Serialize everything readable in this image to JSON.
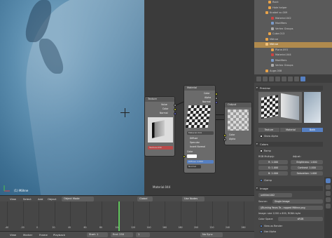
{
  "viewport": {
    "object_label": "(1) Mähne",
    "mode": "Object Mode"
  },
  "node_editor": {
    "status_label": "Material.044",
    "nodes": {
      "texture": {
        "title": "Texture",
        "outputs": [
          "Value",
          "Color",
          "Normal"
        ],
        "texture_name": "Texture.034"
      },
      "material": {
        "title": "Material",
        "outputs": [
          "Color",
          "Alpha",
          "Normal"
        ],
        "inputs": [
          "Color",
          "Spec",
          "Refl",
          "Normal"
        ],
        "options": [
          "Diffuse",
          "Specular",
          "Invert Normal"
        ],
        "material_name": "Material.044",
        "diffuse_value": "Diffuse: 0.800",
        "blend_label": "Normal"
      },
      "output": {
        "title": "Output",
        "inputs": [
          "Color",
          "Alpha"
        ]
      }
    }
  },
  "outliner": {
    "items": [
      {
        "label": "Rock",
        "state": "normal"
      },
      {
        "label": "Hole helper",
        "state": "normal"
      },
      {
        "label": "Knabel sc.009",
        "state": "normal"
      },
      {
        "label": "Material.042",
        "state": "normal"
      },
      {
        "label": "Modifiers",
        "state": "normal"
      },
      {
        "label": "Vertex Groups",
        "state": "normal"
      },
      {
        "label": "Cube.013",
        "state": "sel"
      },
      {
        "label": "Mähne",
        "state": "normal"
      },
      {
        "label": "Mähne",
        "state": "act"
      },
      {
        "label": "Plane.093",
        "state": "normal"
      },
      {
        "label": "Material.044",
        "state": "normal"
      },
      {
        "label": "Modifiers",
        "state": "normal"
      },
      {
        "label": "Vertex Groups",
        "state": "normal"
      },
      {
        "label": "Auge.008",
        "state": "normal"
      },
      {
        "label": "Auge.009",
        "state": "normal"
      }
    ]
  },
  "properties": {
    "preview_title": "Preview",
    "preview_tabs": [
      "Texture",
      "Material",
      "Both"
    ],
    "preview_tab_active": "Both",
    "show_alpha": "Show Alpha",
    "colors_title": "Colors",
    "ramp": "Ramp",
    "rgb_multiply": "RGB Multiply:",
    "adjust": "Adjust:",
    "r": "R:",
    "r_val": "1.000",
    "g": "G:",
    "g_val": "1.000",
    "b": "B:",
    "b_val": "1.000",
    "brightness": "Brightness:",
    "brightness_val": "1.000",
    "contrast": "Contrast:",
    "contrast_val": "1.000",
    "saturation": "Saturation:",
    "saturation_val": "1.000",
    "clamp": "Clamp",
    "image_title": "Image",
    "image_name": "untitled.002",
    "source_label": "Source:",
    "source_value": "Single Image",
    "file_path": "//Burning Years Te...rapped Mähne.png",
    "image_size": "Image: size 1200 x 600, RGBA byte",
    "color_space_label": "Color Space:",
    "color_space_value": "sRGB",
    "view_as_render": "View as Render",
    "use_alpha": "Use Alpha"
  },
  "timeline": {
    "menus": [
      "View",
      "Select",
      "Add",
      "Object"
    ],
    "grease_pencil": "Global",
    "use_nodes": "Use Nodes",
    "frame_labels": [
      "-40",
      "-20",
      "0",
      "20",
      "40",
      "60",
      "80",
      "100",
      "120",
      "140",
      "160",
      "180",
      "200",
      "220",
      "240",
      "260"
    ],
    "footer_menus": [
      "View",
      "Marker",
      "Frame",
      "Playback"
    ],
    "start": "Start: 1",
    "end": "End: 250",
    "current": "1",
    "sync": "No Sync"
  },
  "colors": {
    "accent": "#5680c2",
    "active_orange": "#b08a4d",
    "playhead": "#62c75e"
  }
}
